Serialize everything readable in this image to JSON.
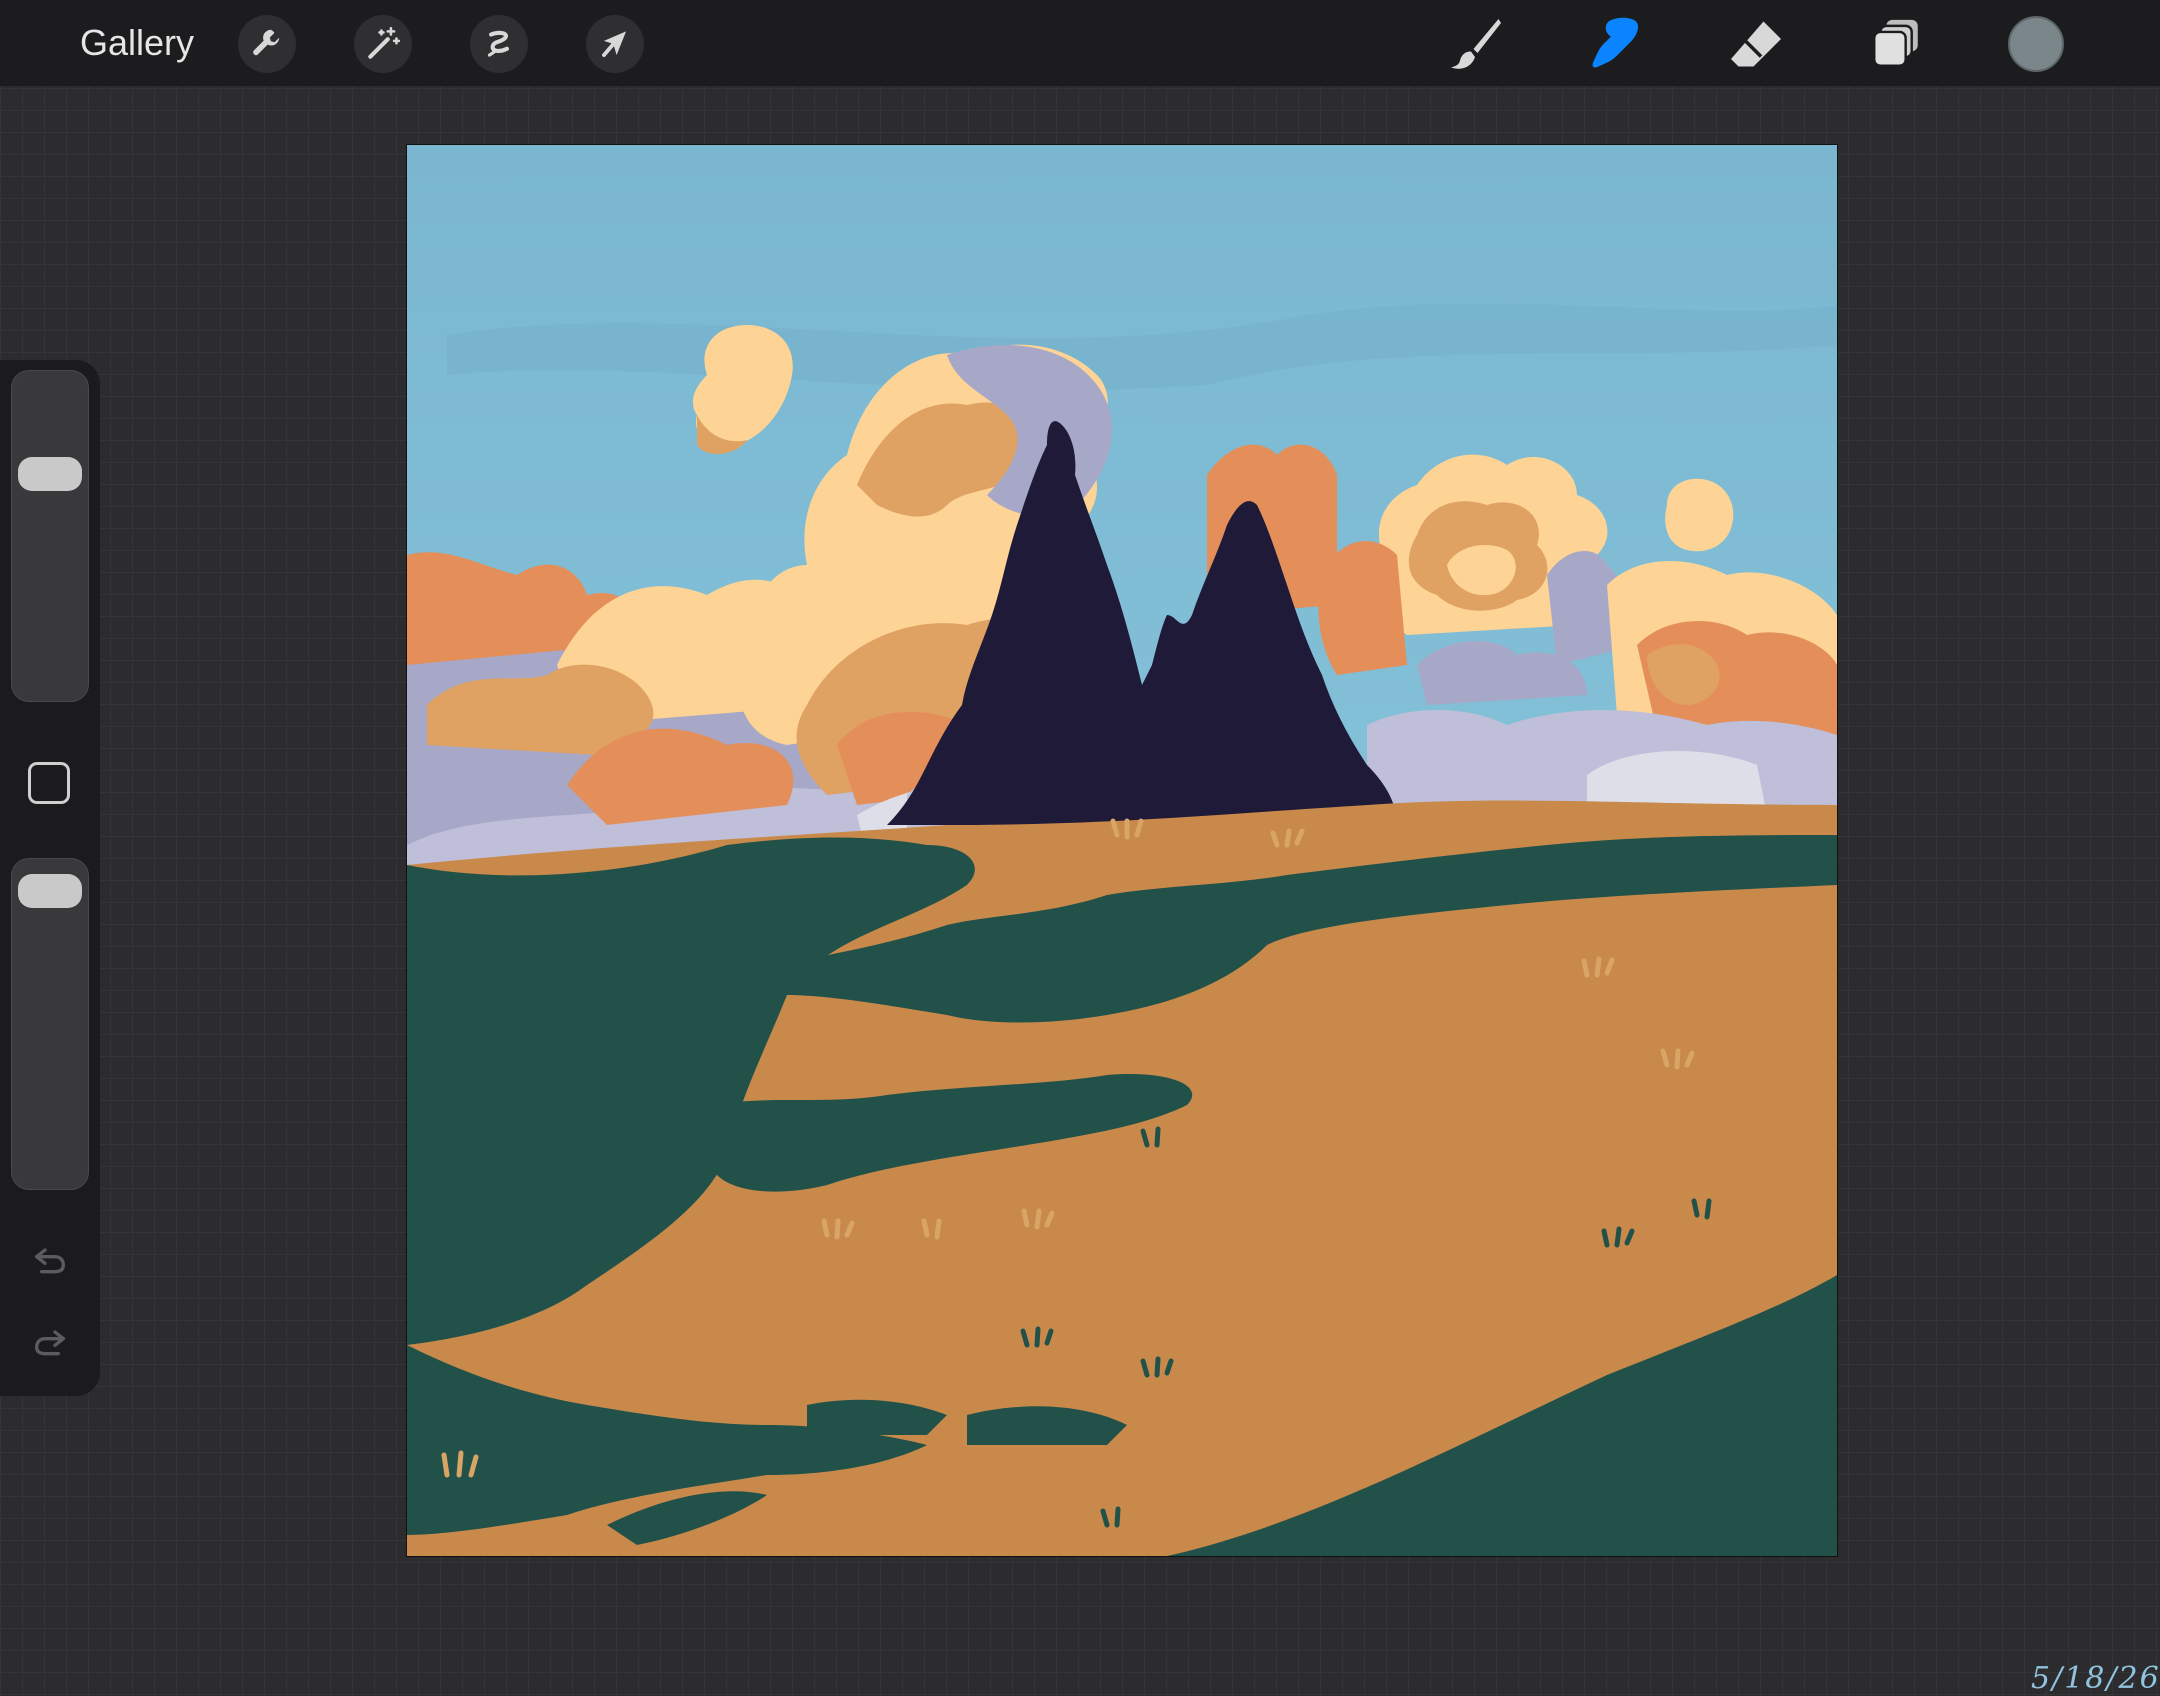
{
  "topbar": {
    "gallery_label": "Gallery",
    "left_tools": [
      "wrench-icon",
      "magic-wand-icon",
      "selection-icon",
      "transform-arrow-icon"
    ],
    "right_tools": [
      "brush-icon",
      "smudge-icon",
      "eraser-icon",
      "layers-icon"
    ],
    "active_tool": "smudge-icon",
    "active_color": "#0a84ff",
    "current_color": "#7b868a"
  },
  "sidebar": {
    "brush_size_level": 0.72,
    "opacity_level": 0.97,
    "controls": [
      "brush-size-slider",
      "modify-button",
      "opacity-slider",
      "undo-icon",
      "redo-icon"
    ]
  },
  "canvas": {
    "signature_date": "5/18/26",
    "palette": {
      "sky": "#79b8d3",
      "cloud_light": "#fdd496",
      "cloud_mid": "#dfa262",
      "cloud_orange": "#e48f5a",
      "cloud_lavender": "#a7a7c7",
      "trees": "#1e1a38",
      "field_gold": "#c9894a",
      "field_green": "#22514a"
    }
  }
}
